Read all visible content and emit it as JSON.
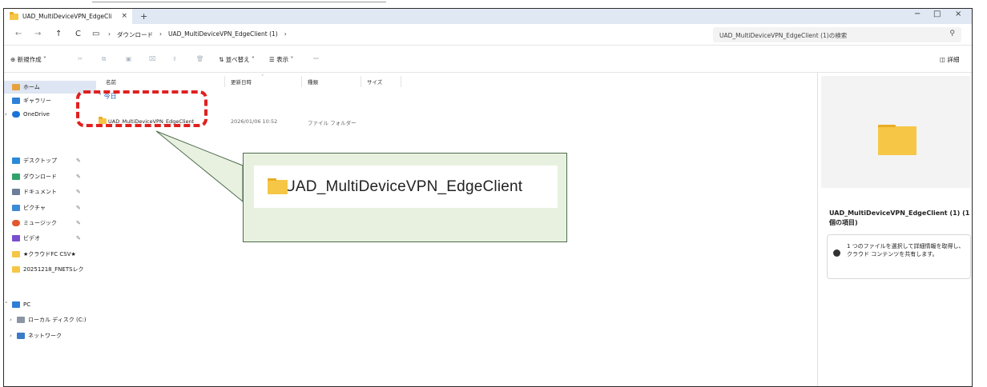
{
  "window": {
    "tab_title": "UAD_MultiDeviceVPN_EdgeCli",
    "tab_close": "×",
    "new_tab": "+",
    "minimize": "−",
    "maximize": "□",
    "close": "×"
  },
  "address": {
    "breadcrumbs": [
      "ダウンロード",
      "UAD_MultiDeviceVPN_EdgeClient (1)"
    ],
    "search_placeholder": "UAD_MultiDeviceVPN_EdgeClient (1)の検索"
  },
  "toolbar": {
    "new_label": "新規作成",
    "sort_label": "並べ替え",
    "view_label": "表示",
    "more_label": "···",
    "details_label": "詳細"
  },
  "sidebar": {
    "items": [
      {
        "label": "ホーム",
        "icon": "home-icon"
      },
      {
        "label": "ギャラリー",
        "icon": "gallery-icon"
      },
      {
        "label": "OneDrive",
        "icon": "cloud-icon"
      },
      {
        "label": "デスクトップ",
        "icon": "desktop-icon"
      },
      {
        "label": "ダウンロード",
        "icon": "download-icon"
      },
      {
        "label": "ドキュメント",
        "icon": "document-icon"
      },
      {
        "label": "ピクチャ",
        "icon": "picture-icon"
      },
      {
        "label": "ミュージック",
        "icon": "music-icon"
      },
      {
        "label": "ビデオ",
        "icon": "video-icon"
      },
      {
        "label": "★クラウドFC CSV★",
        "icon": "folder-icon"
      },
      {
        "label": "20251218_FNETSレク",
        "icon": "folder-icon"
      },
      {
        "label": "PC",
        "icon": "pc-icon"
      },
      {
        "label": "ローカル ディスク (C:)",
        "icon": "drive-icon"
      },
      {
        "label": "ネットワーク",
        "icon": "network-icon"
      }
    ]
  },
  "columns": [
    "名前",
    "更新日時",
    "種類",
    "サイズ"
  ],
  "group_label": "今日",
  "files": [
    {
      "name": "UAD_MultiDeviceVPN_EdgeClient",
      "modified": "2026/01/06 10:52",
      "type": "ファイル フォルダー",
      "size": ""
    }
  ],
  "callout": {
    "name": "UAD_MultiDeviceVPN_EdgeClient"
  },
  "details": {
    "title": "UAD_MultiDeviceVPN_EdgeClient (1) (1 個の項目)",
    "info": "1 つのファイルを選択して詳細情報を取得し、クラウド コンテンツを共有します。"
  },
  "colors": {
    "accent": "#1a5fb4",
    "highlight": "#e0201f",
    "callout_bg": "#e8f1df",
    "folder": "#f6c646"
  }
}
